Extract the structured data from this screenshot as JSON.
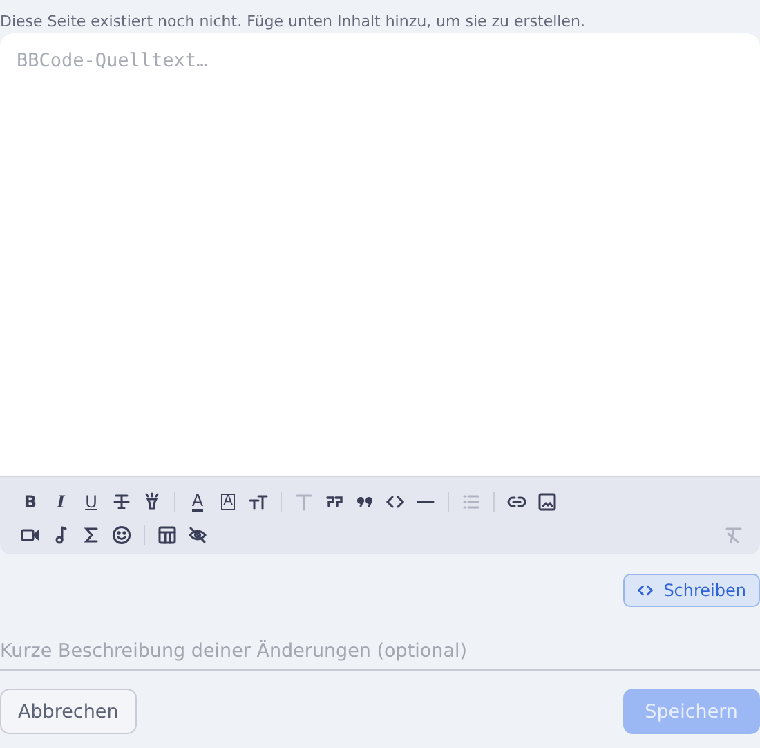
{
  "notice": "Diese Seite existiert noch nicht. Füge unten Inhalt hinzu, um sie zu erstellen.",
  "editor": {
    "placeholder": "BBCode-Quelltext…"
  },
  "toolbar": {
    "rows": [
      [
        {
          "kind": "bold",
          "glyph": "B",
          "disabled": false
        },
        {
          "kind": "italic",
          "glyph": "I",
          "disabled": false
        },
        {
          "kind": "underline",
          "glyph": "U",
          "disabled": false
        },
        {
          "kind": "strike",
          "disabled": false
        },
        {
          "kind": "highlight",
          "disabled": false
        },
        {
          "kind": "separator"
        },
        {
          "kind": "color",
          "glyph": "A",
          "disabled": false
        },
        {
          "kind": "boxed",
          "glyph": "A",
          "disabled": false
        },
        {
          "kind": "size",
          "disabled": false
        },
        {
          "kind": "separator"
        },
        {
          "kind": "heading",
          "disabled": true
        },
        {
          "kind": "quote-open",
          "disabled": false
        },
        {
          "kind": "quote-close",
          "disabled": false
        },
        {
          "kind": "code",
          "disabled": false
        },
        {
          "kind": "rule",
          "disabled": false
        },
        {
          "kind": "separator"
        },
        {
          "kind": "list",
          "disabled": true
        },
        {
          "kind": "separator"
        },
        {
          "kind": "link",
          "disabled": false
        },
        {
          "kind": "image",
          "disabled": false
        }
      ],
      [
        {
          "kind": "video",
          "disabled": false
        },
        {
          "kind": "music",
          "disabled": false
        },
        {
          "kind": "sigma",
          "disabled": false
        },
        {
          "kind": "emoji",
          "disabled": false
        },
        {
          "kind": "separator"
        },
        {
          "kind": "table",
          "disabled": false
        },
        {
          "kind": "hidden",
          "disabled": false
        },
        {
          "kind": "spacer"
        },
        {
          "kind": "clear",
          "disabled": true
        }
      ]
    ]
  },
  "mode_button": {
    "label": "Schreiben"
  },
  "summary": {
    "placeholder": "Kurze Beschreibung deiner Änderungen (optional)"
  },
  "buttons": [
    {
      "label": "Abbrechen",
      "kind": "secondary",
      "disabled": false
    },
    {
      "label": "Speichern",
      "kind": "primary",
      "disabled": true
    }
  ]
}
